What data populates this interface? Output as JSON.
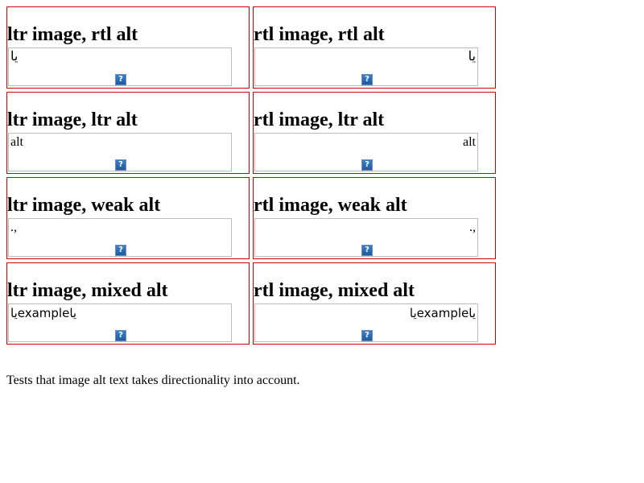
{
  "cases": [
    {
      "heading": "ltr image, rtl alt",
      "alt": "يا"
    },
    {
      "heading": "rtl image, rtl alt",
      "alt": "يا"
    },
    {
      "heading": "ltr image, ltr alt",
      "alt": "alt"
    },
    {
      "heading": "rtl image, ltr alt",
      "alt": "alt"
    },
    {
      "heading": "ltr image, weak alt",
      "alt": ".,"
    },
    {
      "heading": "rtl image, weak alt",
      "alt": ".,"
    },
    {
      "heading": "ltr image, mixed alt",
      "alt": "ياexampleيا"
    },
    {
      "heading": "rtl image, mixed alt",
      "alt": "ياexampleيا"
    }
  ],
  "broken_image_glyph": "?",
  "description": "Tests that image alt text takes directionality into account."
}
